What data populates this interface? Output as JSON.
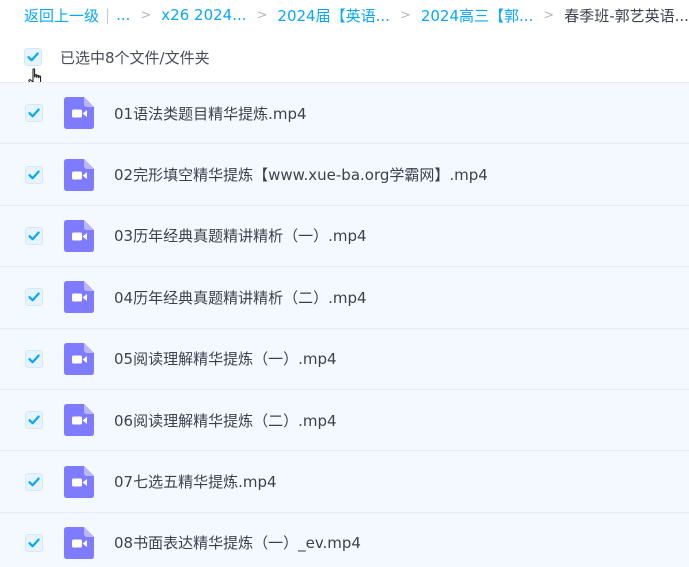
{
  "breadcrumb": {
    "back": "返回上一级",
    "ellipsis": "...",
    "items": [
      "x26 2024...",
      "2024届【英语...",
      "2024高三【郭...",
      "春季班-郭艺英语..."
    ]
  },
  "selection": {
    "summary": "已选中8个文件/文件夹"
  },
  "files": [
    {
      "name": "01语法类题目精华提炼.mp4"
    },
    {
      "name": "02完形填空精华提炼【www.xue-ba.org学霸网】.mp4"
    },
    {
      "name": "03历年经典真题精讲精析（一）.mp4"
    },
    {
      "name": "04历年经典真题精讲精析（二）.mp4"
    },
    {
      "name": "05阅读理解精华提炼（一）.mp4"
    },
    {
      "name": "06阅读理解精华提炼（二）.mp4"
    },
    {
      "name": "07七选五精华提炼.mp4"
    },
    {
      "name": "08书面表达精华提炼（一）_ev.mp4"
    }
  ],
  "colors": {
    "accent": "#06a7ff",
    "video_icon": "#7f7bff",
    "row_bg": "#f4f9ff"
  },
  "icons": {
    "checkbox": "check-icon",
    "file": "video-file-icon",
    "cursor": "hand-cursor-icon"
  }
}
